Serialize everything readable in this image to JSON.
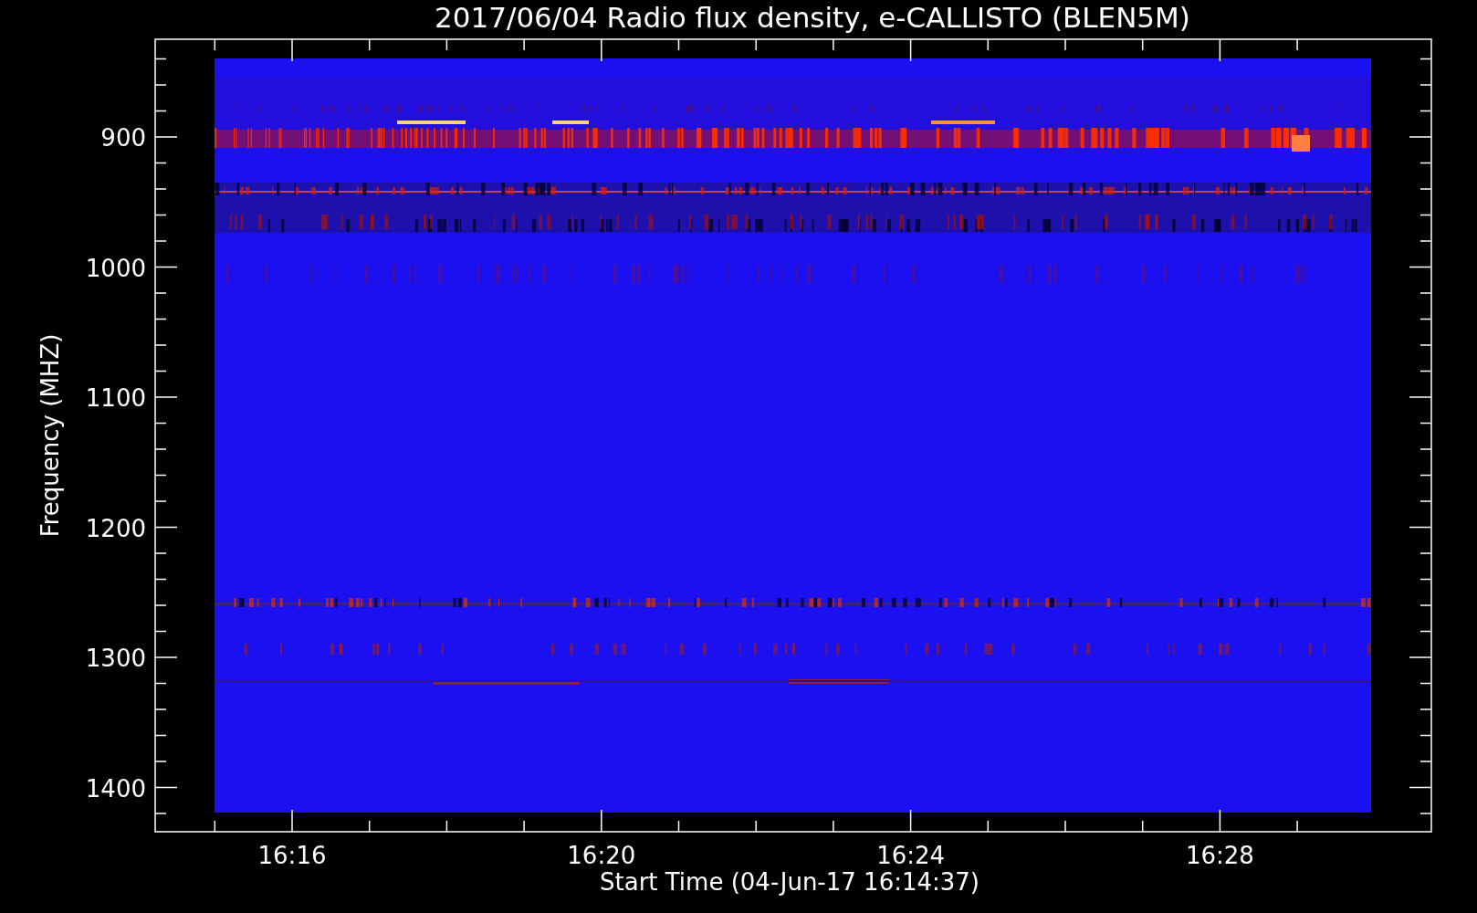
{
  "title": "2017/06/04  Radio flux density, e-CALLISTO (BLEN5M)",
  "ylabel": "Frequency (MHZ)",
  "xlabel": "Start Time (04-Jun-17 16:14:37)",
  "yticks": [
    "900",
    "1000",
    "1100",
    "1200",
    "1300",
    "1400"
  ],
  "xticks": [
    "16:16",
    "16:20",
    "16:24",
    "16:28"
  ]
}
